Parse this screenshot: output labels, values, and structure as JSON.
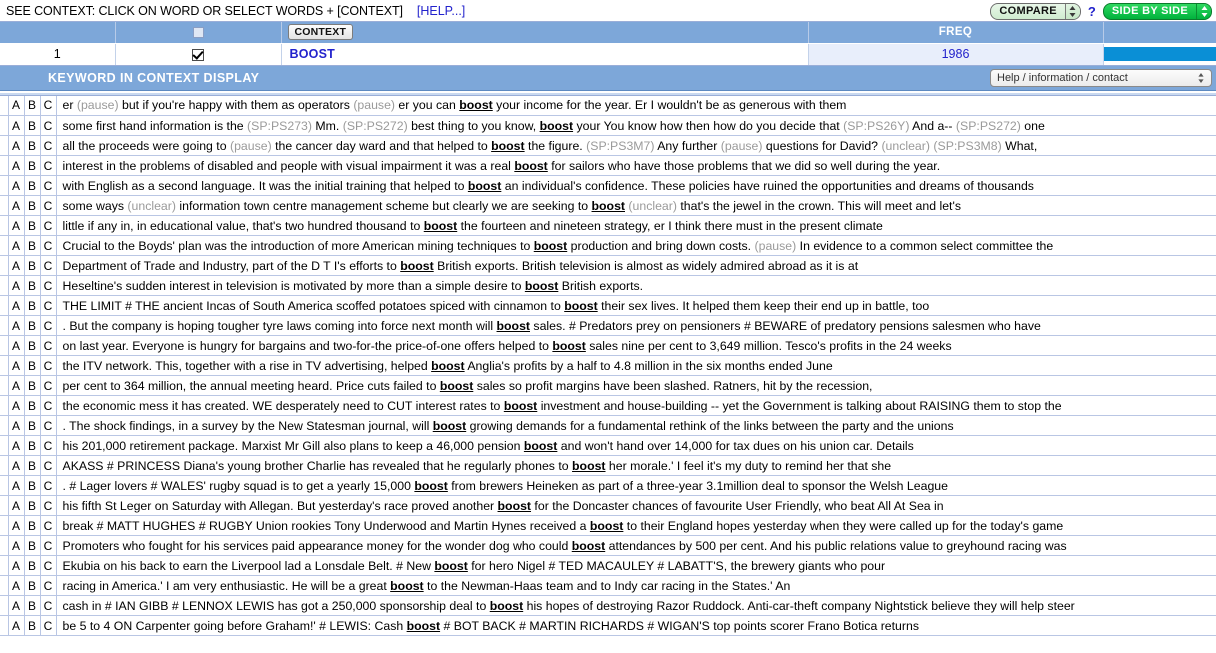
{
  "titlebar": {
    "instruction": "SEE CONTEXT: CLICK ON WORD OR SELECT WORDS + [CONTEXT]",
    "help_link": "[HELP...]",
    "compare_label": "COMPARE",
    "question_mark": "?",
    "side_by_side_label": "SIDE BY SIDE"
  },
  "word_table": {
    "headers": {
      "num": "",
      "check": "",
      "context_button": "CONTEXT",
      "blank": "",
      "freq": "FREQ",
      "bar": ""
    },
    "rows": [
      {
        "num": "1",
        "word": "BOOST",
        "freq": "1986",
        "bar_percent": 100,
        "checked": true
      }
    ]
  },
  "kwic": {
    "banner_title": "KEYWORD IN CONTEXT DISPLAY",
    "help_select_value": "Help / information / contact"
  },
  "concordance": {
    "col_a": "A",
    "col_b": "B",
    "col_c": "C",
    "lines": [
      {
        "parts": [
          {
            "t": "er ",
            "s": "plain"
          },
          {
            "t": "(pause)",
            "s": "tag"
          },
          {
            "t": " but if you're happy with them as operators ",
            "s": "plain"
          },
          {
            "t": "(pause)",
            "s": "tag"
          },
          {
            "t": " er you can ",
            "s": "plain"
          },
          {
            "t": "boost",
            "s": "kw"
          },
          {
            "t": " your income for the year. Er I wouldn't be as generous with them",
            "s": "plain"
          }
        ]
      },
      {
        "parts": [
          {
            "t": "some first hand information is the ",
            "s": "plain"
          },
          {
            "t": "(SP:PS273)",
            "s": "tag"
          },
          {
            "t": " Mm. ",
            "s": "plain"
          },
          {
            "t": "(SP:PS272)",
            "s": "tag"
          },
          {
            "t": " best thing to you know, ",
            "s": "plain"
          },
          {
            "t": "boost",
            "s": "kw"
          },
          {
            "t": " your You know how then how do you decide that ",
            "s": "plain"
          },
          {
            "t": "(SP:PS26Y)",
            "s": "tag"
          },
          {
            "t": " And a-- ",
            "s": "plain"
          },
          {
            "t": "(SP:PS272)",
            "s": "tag"
          },
          {
            "t": " one",
            "s": "plain"
          }
        ]
      },
      {
        "parts": [
          {
            "t": "all the proceeds were going to ",
            "s": "plain"
          },
          {
            "t": "(pause)",
            "s": "tag"
          },
          {
            "t": " the cancer day ward and that helped to ",
            "s": "plain"
          },
          {
            "t": "boost",
            "s": "kw"
          },
          {
            "t": " the figure. ",
            "s": "plain"
          },
          {
            "t": "(SP:PS3M7)",
            "s": "tag"
          },
          {
            "t": " Any further ",
            "s": "plain"
          },
          {
            "t": "(pause)",
            "s": "tag"
          },
          {
            "t": " questions for David? ",
            "s": "plain"
          },
          {
            "t": "(unclear)",
            "s": "tag"
          },
          {
            "t": " ",
            "s": "plain"
          },
          {
            "t": "(SP:PS3M8)",
            "s": "tag"
          },
          {
            "t": " What,",
            "s": "plain"
          }
        ]
      },
      {
        "parts": [
          {
            "t": "interest in the problems of disabled and people with visual impairment it was a real ",
            "s": "plain"
          },
          {
            "t": "boost",
            "s": "kw"
          },
          {
            "t": " for sailors who have those problems that we did so well during the year.",
            "s": "plain"
          }
        ]
      },
      {
        "parts": [
          {
            "t": "with English as a second language. It was the initial training that helped to ",
            "s": "plain"
          },
          {
            "t": "boost",
            "s": "kw"
          },
          {
            "t": " an individual's confidence. These policies have ruined the opportunities and dreams of thousands",
            "s": "plain"
          }
        ]
      },
      {
        "parts": [
          {
            "t": "some ways ",
            "s": "plain"
          },
          {
            "t": "(unclear)",
            "s": "tag"
          },
          {
            "t": " information town centre management scheme but clearly we are seeking to ",
            "s": "plain"
          },
          {
            "t": "boost",
            "s": "kw"
          },
          {
            "t": " ",
            "s": "plain"
          },
          {
            "t": "(unclear)",
            "s": "tag"
          },
          {
            "t": " that's the jewel in the crown. This will meet and let's",
            "s": "plain"
          }
        ]
      },
      {
        "parts": [
          {
            "t": "little if any in, in educational value, that's two hundred thousand to ",
            "s": "plain"
          },
          {
            "t": "boost",
            "s": "kw"
          },
          {
            "t": " the fourteen and nineteen strategy, er I think there must in the present climate",
            "s": "plain"
          }
        ]
      },
      {
        "parts": [
          {
            "t": "Crucial to the Boyds' plan was the introduction of more American mining techniques to ",
            "s": "plain"
          },
          {
            "t": "boost",
            "s": "kw"
          },
          {
            "t": " production and bring down costs. ",
            "s": "plain"
          },
          {
            "t": "(pause)",
            "s": "tag"
          },
          {
            "t": " In evidence to a common select committee the",
            "s": "plain"
          }
        ]
      },
      {
        "parts": [
          {
            "t": "Department of Trade and Industry, part of the D T I's efforts to ",
            "s": "plain"
          },
          {
            "t": "boost",
            "s": "kw"
          },
          {
            "t": " British exports. British television is almost as widely admired abroad as it is at",
            "s": "plain"
          }
        ]
      },
      {
        "parts": [
          {
            "t": "Heseltine's sudden interest in television is motivated by more than a simple desire to ",
            "s": "plain"
          },
          {
            "t": "boost",
            "s": "kw"
          },
          {
            "t": " British exports.",
            "s": "plain"
          }
        ]
      },
      {
        "parts": [
          {
            "t": "THE LIMIT # THE ancient Incas of South America scoffed potatoes spiced with cinnamon to ",
            "s": "plain"
          },
          {
            "t": "boost",
            "s": "kw"
          },
          {
            "t": " their sex lives. It helped them keep their end up in battle, too",
            "s": "plain"
          }
        ]
      },
      {
        "parts": [
          {
            "t": ". But the company is hoping tougher tyre laws coming into force next month will ",
            "s": "plain"
          },
          {
            "t": "boost",
            "s": "kw"
          },
          {
            "t": " sales. # Predators prey on pensioners # BEWARE of predatory pensions salesmen who have",
            "s": "plain"
          }
        ]
      },
      {
        "parts": [
          {
            "t": "on last year. Everyone is hungry for bargains and two-for-the price-of-one offers helped to ",
            "s": "plain"
          },
          {
            "t": "boost",
            "s": "kw"
          },
          {
            "t": " sales nine per cent to 3,649 million. Tesco's profits in the 24 weeks",
            "s": "plain"
          }
        ]
      },
      {
        "parts": [
          {
            "t": "the ITV network. This, together with a rise in TV advertising, helped ",
            "s": "plain"
          },
          {
            "t": "boost",
            "s": "kw"
          },
          {
            "t": " Anglia's profits by a half to 4.8 million in the six months ended June",
            "s": "plain"
          }
        ]
      },
      {
        "parts": [
          {
            "t": "per cent to 364 million, the annual meeting heard. Price cuts failed to ",
            "s": "plain"
          },
          {
            "t": "boost",
            "s": "kw"
          },
          {
            "t": " sales so profit margins have been slashed. Ratners, hit by the recession,",
            "s": "plain"
          }
        ]
      },
      {
        "parts": [
          {
            "t": "the economic mess it has created. WE desperately need to CUT interest rates to ",
            "s": "plain"
          },
          {
            "t": "boost",
            "s": "kw"
          },
          {
            "t": " investment and house-building -- yet the Government is talking about RAISING them to stop the",
            "s": "plain"
          }
        ]
      },
      {
        "parts": [
          {
            "t": ". The shock findings, in a survey by the New Statesman journal, will ",
            "s": "plain"
          },
          {
            "t": "boost",
            "s": "kw"
          },
          {
            "t": " growing demands for a fundamental rethink of the links between the party and the unions",
            "s": "plain"
          }
        ]
      },
      {
        "parts": [
          {
            "t": "his 201,000 retirement package. Marxist Mr Gill also plans to keep a 46,000 pension ",
            "s": "plain"
          },
          {
            "t": "boost",
            "s": "kw"
          },
          {
            "t": " and won't hand over 14,000 for tax dues on his union car. Details",
            "s": "plain"
          }
        ]
      },
      {
        "parts": [
          {
            "t": "AKASS # PRINCESS Diana's young brother Charlie has revealed that he regularly phones to ",
            "s": "plain"
          },
          {
            "t": "boost",
            "s": "kw"
          },
          {
            "t": " her morale.' I feel it's my duty to remind her that she",
            "s": "plain"
          }
        ]
      },
      {
        "parts": [
          {
            "t": ". # Lager lovers # WALES' rugby squad is to get a yearly 15,000 ",
            "s": "plain"
          },
          {
            "t": "boost",
            "s": "kw"
          },
          {
            "t": " from brewers Heineken as part of a three-year 3.1million deal to sponsor the Welsh League",
            "s": "plain"
          }
        ]
      },
      {
        "parts": [
          {
            "t": "his fifth St Leger on Saturday with Allegan. But yesterday's race proved another ",
            "s": "plain"
          },
          {
            "t": "boost",
            "s": "kw"
          },
          {
            "t": " for the Doncaster chances of favourite User Friendly, who beat All At Sea in",
            "s": "plain"
          }
        ]
      },
      {
        "parts": [
          {
            "t": "break # MATT HUGHES # RUGBY Union rookies Tony Underwood and Martin Hynes received a ",
            "s": "plain"
          },
          {
            "t": "boost",
            "s": "kw"
          },
          {
            "t": " to their England hopes yesterday when they were called up for the today's game",
            "s": "plain"
          }
        ]
      },
      {
        "parts": [
          {
            "t": "Promoters who fought for his services paid appearance money for the wonder dog who could ",
            "s": "plain"
          },
          {
            "t": "boost",
            "s": "kw"
          },
          {
            "t": " attendances by 500 per cent. And his public relations value to greyhound racing was",
            "s": "plain"
          }
        ]
      },
      {
        "parts": [
          {
            "t": "Ekubia on his back to earn the Liverpool lad a Lonsdale Belt. # New ",
            "s": "plain"
          },
          {
            "t": "boost",
            "s": "kw"
          },
          {
            "t": " for hero Nigel # TED MACAULEY # LABATT'S, the brewery giants who pour",
            "s": "plain"
          }
        ]
      },
      {
        "parts": [
          {
            "t": "racing in America.' I am very enthusiastic. He will be a great ",
            "s": "plain"
          },
          {
            "t": "boost",
            "s": "kw"
          },
          {
            "t": " to the Newman-Haas team and to Indy car racing in the States.' An",
            "s": "plain"
          }
        ]
      },
      {
        "parts": [
          {
            "t": "cash in # IAN GIBB # LENNOX LEWIS has got a 250,000 sponsorship deal to ",
            "s": "plain"
          },
          {
            "t": "boost",
            "s": "kw"
          },
          {
            "t": " his hopes of destroying Razor Ruddock. Anti-car-theft company Nightstick believe they will help steer",
            "s": "plain"
          }
        ]
      },
      {
        "parts": [
          {
            "t": "be 5 to 4 ON Carpenter going before Graham!' # LEWIS: Cash ",
            "s": "plain"
          },
          {
            "t": "boost",
            "s": "kw"
          },
          {
            "t": " # BOT BACK # MARTIN RICHARDS # WIGAN'S top points scorer Frano Botica returns",
            "s": "plain"
          }
        ]
      }
    ]
  },
  "colors": {
    "header_blue": "#7da7d9",
    "bar_blue": "#0a8fd6",
    "link_blue": "#2222cc",
    "freq_cell": "#e8eefb",
    "sbs_green": "#00b23d",
    "tag_grey": "#9a9a9a"
  }
}
